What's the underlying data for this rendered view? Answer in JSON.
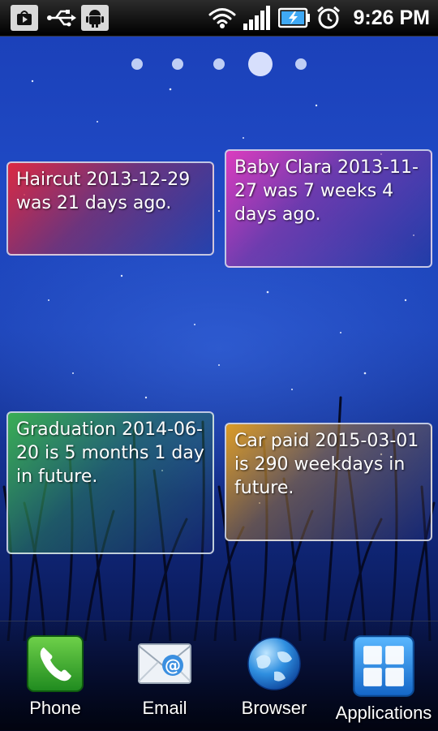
{
  "status_bar": {
    "clock": "9:26 PM",
    "left_icons": [
      "play-store-notification-icon",
      "usb-icon",
      "android-debug-icon"
    ],
    "right_icons": [
      "wifi-icon",
      "signal-icon",
      "battery-charging-icon",
      "alarm-icon"
    ]
  },
  "page_indicator": {
    "pages": 5,
    "current": 4
  },
  "widgets": [
    {
      "text": "Haircut 2013-12-29 was 21 days ago.",
      "color": "#e8283c"
    },
    {
      "text": "Baby Clara 2013-11-27 was 7 weeks 4 days ago.",
      "color": "#e63cbe"
    },
    {
      "text": "Graduation 2014-06-20 is 5 months 1 day in future.",
      "color": "#3cb450"
    },
    {
      "text": "Car paid 2015-03-01 is 290 weekdays in future.",
      "color": "#e6a01e"
    }
  ],
  "dock": {
    "items": [
      {
        "label": "Phone",
        "icon": "phone-icon"
      },
      {
        "label": "Email",
        "icon": "email-icon"
      },
      {
        "label": "Browser",
        "icon": "browser-globe-icon"
      },
      {
        "label": "Applications",
        "icon": "applications-grid-icon"
      }
    ]
  }
}
